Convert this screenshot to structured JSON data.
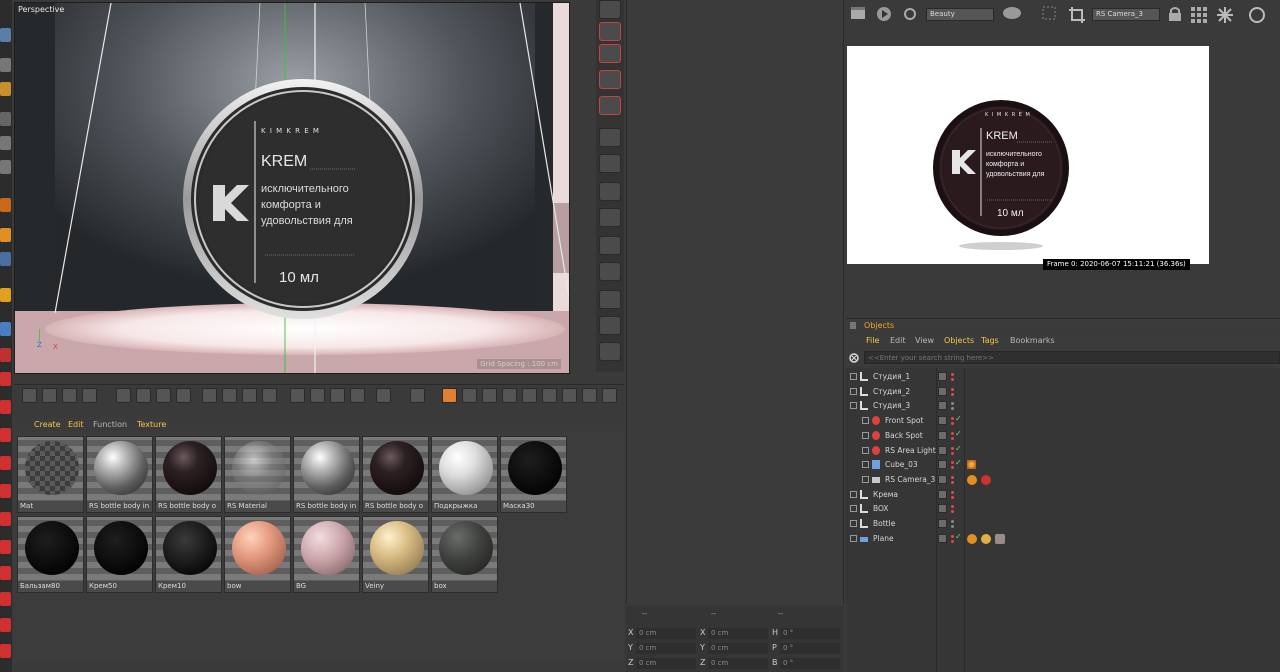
{
  "viewport": {
    "label": "Perspective",
    "grid_spacing": "Grid Spacing : 100 cm",
    "label_brand": "K I M K R E M",
    "label_title": "KREM",
    "label_lines": [
      "исключительного",
      "комфорта и",
      "удовольствия для"
    ],
    "label_volume": "10 мл",
    "axis_x": "X",
    "axis_z": "Z"
  },
  "material_manager": {
    "menu": [
      "Create",
      "Edit",
      "Function",
      "Texture"
    ],
    "materials": [
      {
        "label": "Mat",
        "style": "checker"
      },
      {
        "label": "RS bottle body in",
        "style": "chrome"
      },
      {
        "label": "RS bottle body o",
        "style": "darkgloss"
      },
      {
        "label": "RS Material",
        "style": "glass"
      },
      {
        "label": "RS bottle body in",
        "style": "chrome"
      },
      {
        "label": "RS bottle body o",
        "style": "darkgloss"
      },
      {
        "label": "Подкрыжка",
        "style": "white"
      },
      {
        "label": "Маска30",
        "style": "black"
      },
      {
        "label": "Бальзам80",
        "style": "black"
      },
      {
        "label": "Крем50",
        "style": "black"
      },
      {
        "label": "Крем10",
        "style": "labeled"
      },
      {
        "label": "bow",
        "style": "peach"
      },
      {
        "label": "BG",
        "style": "pink"
      },
      {
        "label": "Veiny",
        "style": "marble"
      },
      {
        "label": "box",
        "style": "darkgray"
      }
    ]
  },
  "coordinates": {
    "header": [
      "--",
      "--",
      "--"
    ],
    "rows": [
      {
        "a": "X",
        "a_val": "0 cm",
        "b": "X",
        "b_val": "0 cm",
        "c": "H",
        "c_val": "0 °"
      },
      {
        "a": "Y",
        "a_val": "0 cm",
        "b": "Y",
        "b_val": "0 cm",
        "c": "P",
        "c_val": "0 °"
      },
      {
        "a": "Z",
        "a_val": "0 cm",
        "b": "Z",
        "b_val": "0 cm",
        "c": "B",
        "c_val": "0 °"
      }
    ]
  },
  "render_view": {
    "aov": "Beauty",
    "camera": "RS Camera_3",
    "frame_info": "Frame  0:  2020-06-07  15:11:21  (36.36s)",
    "label_brand": "K I M K R E M",
    "label_title": "KREM",
    "label_lines": [
      "исключительного",
      "комфорта и",
      "удовольствия для"
    ],
    "label_volume": "10 мл"
  },
  "object_manager": {
    "title": "Objects",
    "menu": [
      "File",
      "Edit",
      "View",
      "Objects",
      "Tags",
      "Bookmarks"
    ],
    "search_placeholder": "<<Enter your search string here>>",
    "objects": [
      {
        "name": "Студия_1",
        "indent": 0,
        "icon": "null"
      },
      {
        "name": "Студия_2",
        "indent": 0,
        "icon": "null"
      },
      {
        "name": "Студия_3",
        "indent": 0,
        "icon": "null"
      },
      {
        "name": "Front Spot",
        "indent": 1,
        "icon": "light"
      },
      {
        "name": "Back Spot",
        "indent": 1,
        "icon": "light"
      },
      {
        "name": "RS Area Light",
        "indent": 1,
        "icon": "light"
      },
      {
        "name": "Cube_03",
        "indent": 1,
        "icon": "cube"
      },
      {
        "name": "RS Camera_3",
        "indent": 1,
        "icon": "camera"
      },
      {
        "name": "Крема",
        "indent": 0,
        "icon": "null"
      },
      {
        "name": "BOX",
        "indent": 0,
        "icon": "null"
      },
      {
        "name": "Bottle",
        "indent": 0,
        "icon": "null"
      },
      {
        "name": "Plane",
        "indent": 0,
        "icon": "plane"
      }
    ]
  },
  "colors": {
    "menu_accent": "#f5c842",
    "object_title": "#f5a623",
    "check_green": "#7ad07a",
    "dot_red": "#e04848"
  }
}
